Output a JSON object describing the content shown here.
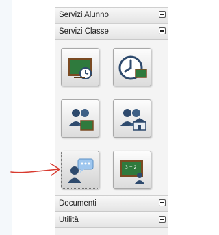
{
  "sections": {
    "servizi_alunno": {
      "title": "Servizi Alunno"
    },
    "servizi_classe": {
      "title": "Servizi Classe"
    },
    "documenti": {
      "title": "Documenti"
    },
    "utilita": {
      "title": "Utilità"
    }
  },
  "icons": [
    {
      "name": "lesson-board-icon"
    },
    {
      "name": "timetable-clock-icon"
    },
    {
      "name": "class-group-icon"
    },
    {
      "name": "group-school-icon"
    },
    {
      "name": "communication-user-icon"
    },
    {
      "name": "math-board-user-icon"
    }
  ],
  "colors": {
    "board_green": "#2f7a3d",
    "person_navy": "#2e4a6d",
    "annotation_red": "#d83a2f"
  }
}
